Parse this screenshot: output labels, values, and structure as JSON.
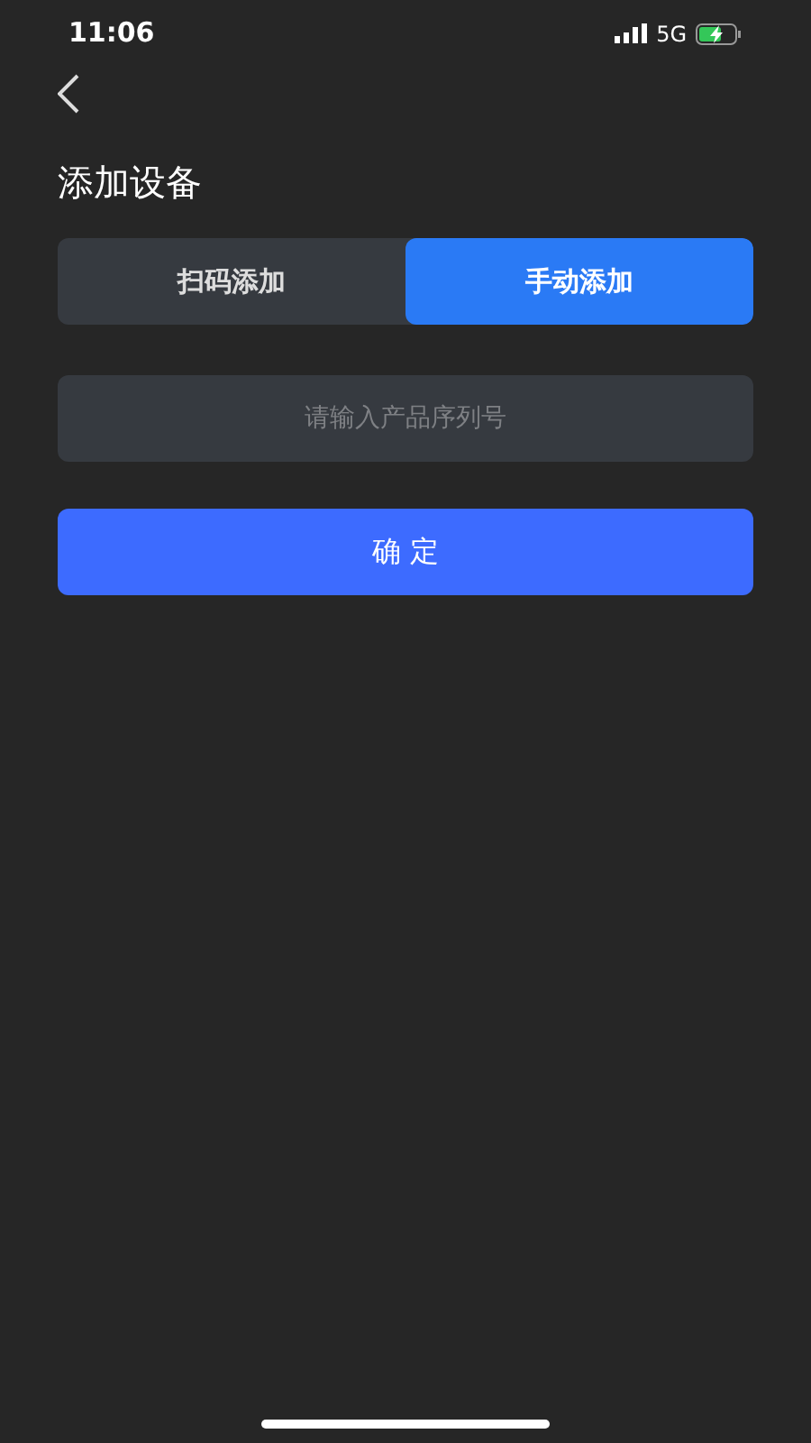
{
  "status_bar": {
    "time": "11:06",
    "network": "5G"
  },
  "title": "添加设备",
  "tabs": [
    {
      "label": "扫码添加",
      "selected": false
    },
    {
      "label": "手动添加",
      "selected": true
    }
  ],
  "serial_field": {
    "placeholder": "请输入产品序列号"
  },
  "confirm_button": {
    "label": "确 定"
  }
}
